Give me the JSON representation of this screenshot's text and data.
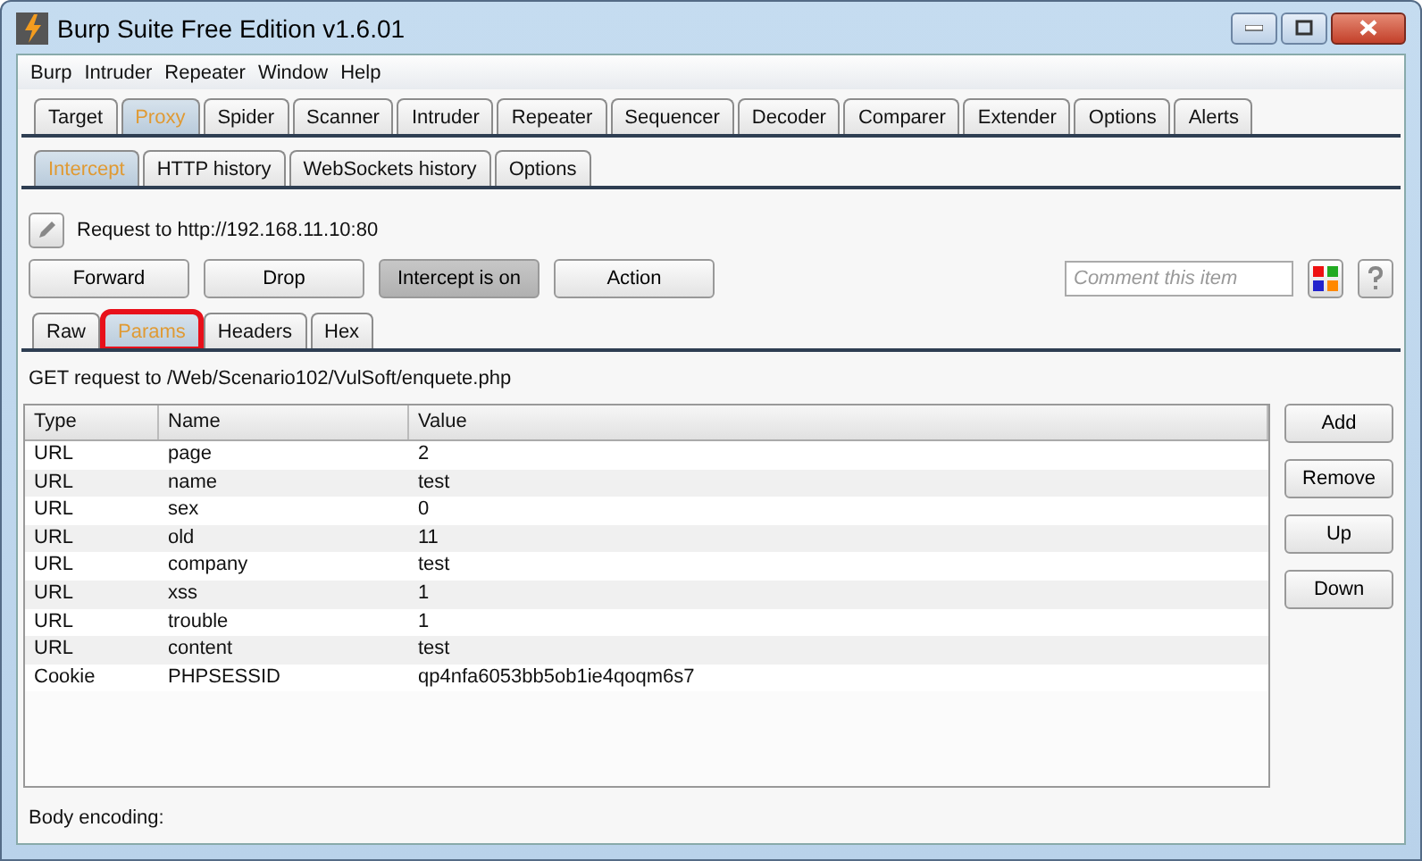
{
  "window": {
    "title": "Burp Suite Free Edition v1.6.01"
  },
  "menu": [
    "Burp",
    "Intruder",
    "Repeater",
    "Window",
    "Help"
  ],
  "main_tabs": [
    {
      "label": "Target",
      "selected": false
    },
    {
      "label": "Proxy",
      "selected": true
    },
    {
      "label": "Spider",
      "selected": false
    },
    {
      "label": "Scanner",
      "selected": false
    },
    {
      "label": "Intruder",
      "selected": false
    },
    {
      "label": "Repeater",
      "selected": false
    },
    {
      "label": "Sequencer",
      "selected": false
    },
    {
      "label": "Decoder",
      "selected": false
    },
    {
      "label": "Comparer",
      "selected": false
    },
    {
      "label": "Extender",
      "selected": false
    },
    {
      "label": "Options",
      "selected": false
    },
    {
      "label": "Alerts",
      "selected": false
    }
  ],
  "proxy_tabs": [
    {
      "label": "Intercept",
      "selected": true
    },
    {
      "label": "HTTP history",
      "selected": false
    },
    {
      "label": "WebSockets history",
      "selected": false
    },
    {
      "label": "Options",
      "selected": false
    }
  ],
  "request_target": "Request to http://192.168.11.10:80",
  "actions": [
    {
      "label": "Forward",
      "pressed": false
    },
    {
      "label": "Drop",
      "pressed": false
    },
    {
      "label": "Intercept is on",
      "pressed": true
    },
    {
      "label": "Action",
      "pressed": false
    }
  ],
  "comment": {
    "placeholder": "Comment this item"
  },
  "message_tabs": [
    {
      "label": "Raw",
      "selected": false,
      "highlighted": false
    },
    {
      "label": "Params",
      "selected": true,
      "highlighted": true
    },
    {
      "label": "Headers",
      "selected": false,
      "highlighted": false
    },
    {
      "label": "Hex",
      "selected": false,
      "highlighted": false
    }
  ],
  "request_line": "GET request to /Web/Scenario102/VulSoft/enquete.php",
  "table": {
    "columns": [
      "Type",
      "Name",
      "Value"
    ],
    "rows": [
      [
        "URL",
        "page",
        "2"
      ],
      [
        "URL",
        "name",
        "test"
      ],
      [
        "URL",
        "sex",
        "0"
      ],
      [
        "URL",
        "old",
        "11"
      ],
      [
        "URL",
        "company",
        "test"
      ],
      [
        "URL",
        "xss",
        "1"
      ],
      [
        "URL",
        "trouble",
        "1"
      ],
      [
        "URL",
        "content",
        "test"
      ],
      [
        "Cookie",
        "PHPSESSID",
        "qp4nfa6053bb5ob1ie4qoqm6s7"
      ]
    ]
  },
  "side_buttons": [
    "Add",
    "Remove",
    "Up",
    "Down"
  ],
  "body_encoding": "Body encoding:"
}
